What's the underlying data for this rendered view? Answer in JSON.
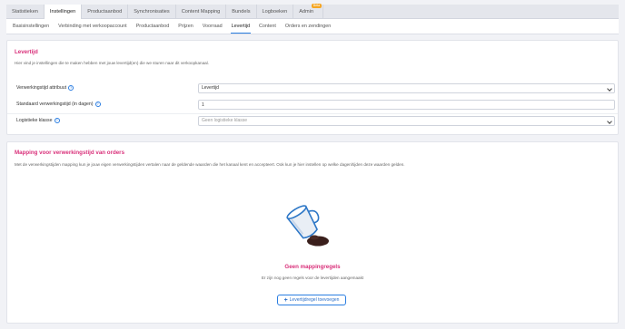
{
  "top_tabs": [
    {
      "label": "Statistieken",
      "active": false
    },
    {
      "label": "Instellingen",
      "active": true
    },
    {
      "label": "Productaanbod",
      "active": false
    },
    {
      "label": "Synchronisaties",
      "active": false
    },
    {
      "label": "Content Mapping",
      "active": false
    },
    {
      "label": "Bundels",
      "active": false
    },
    {
      "label": "Logboeken",
      "active": false
    },
    {
      "label": "Admin",
      "active": false,
      "badge": "Beta"
    }
  ],
  "sub_tabs": [
    {
      "label": "Basisinstellingen",
      "active": false
    },
    {
      "label": "Verbinding met verkoopaccount",
      "active": false
    },
    {
      "label": "Productaanbod",
      "active": false
    },
    {
      "label": "Prijzen",
      "active": false
    },
    {
      "label": "Voorraad",
      "active": false
    },
    {
      "label": "Levertijd",
      "active": true
    },
    {
      "label": "Content",
      "active": false
    },
    {
      "label": "Orders en zendingen",
      "active": false
    }
  ],
  "levertijd": {
    "title": "Levertijd",
    "description": "Hier vind je instellingen die te maken hebben met jouw levertijd(en) die we sturen naar dit verkoopkanaal.",
    "fields": {
      "attribuut": {
        "label": "Verwerkingstijd attribuut",
        "value": "Levertijd"
      },
      "standaard": {
        "label": "Standaard verwerkingstijd (in dagen)",
        "value": "1"
      },
      "logistiek": {
        "label": "Logistieke klasse",
        "placeholder": "Geen logistieke klasse"
      }
    }
  },
  "mapping": {
    "title": "Mapping voor verwerkingstijd van orders",
    "description": "Met de verwerkingstijden mapping kun je jouw eigen verwerkingstijden vertalen naar de geldende waarden die het kanaal kent en accepteert. Ook kun je hier instellen op welke dagen/tijden deze waarden gelden.",
    "empty_title": "Geen mappingregels",
    "empty_desc": "Er zijn nog geen regels voor de levertijden aangemaakt",
    "add_button": "Levertijdregel toevoegen"
  },
  "colors": {
    "accent_pink": "#d9307a",
    "accent_blue": "#2a7de1",
    "page_bg": "#f1f2f6"
  },
  "icons": [
    "help-icon",
    "chevron-down-icon",
    "plus-icon",
    "spilled-cup-illustration"
  ]
}
